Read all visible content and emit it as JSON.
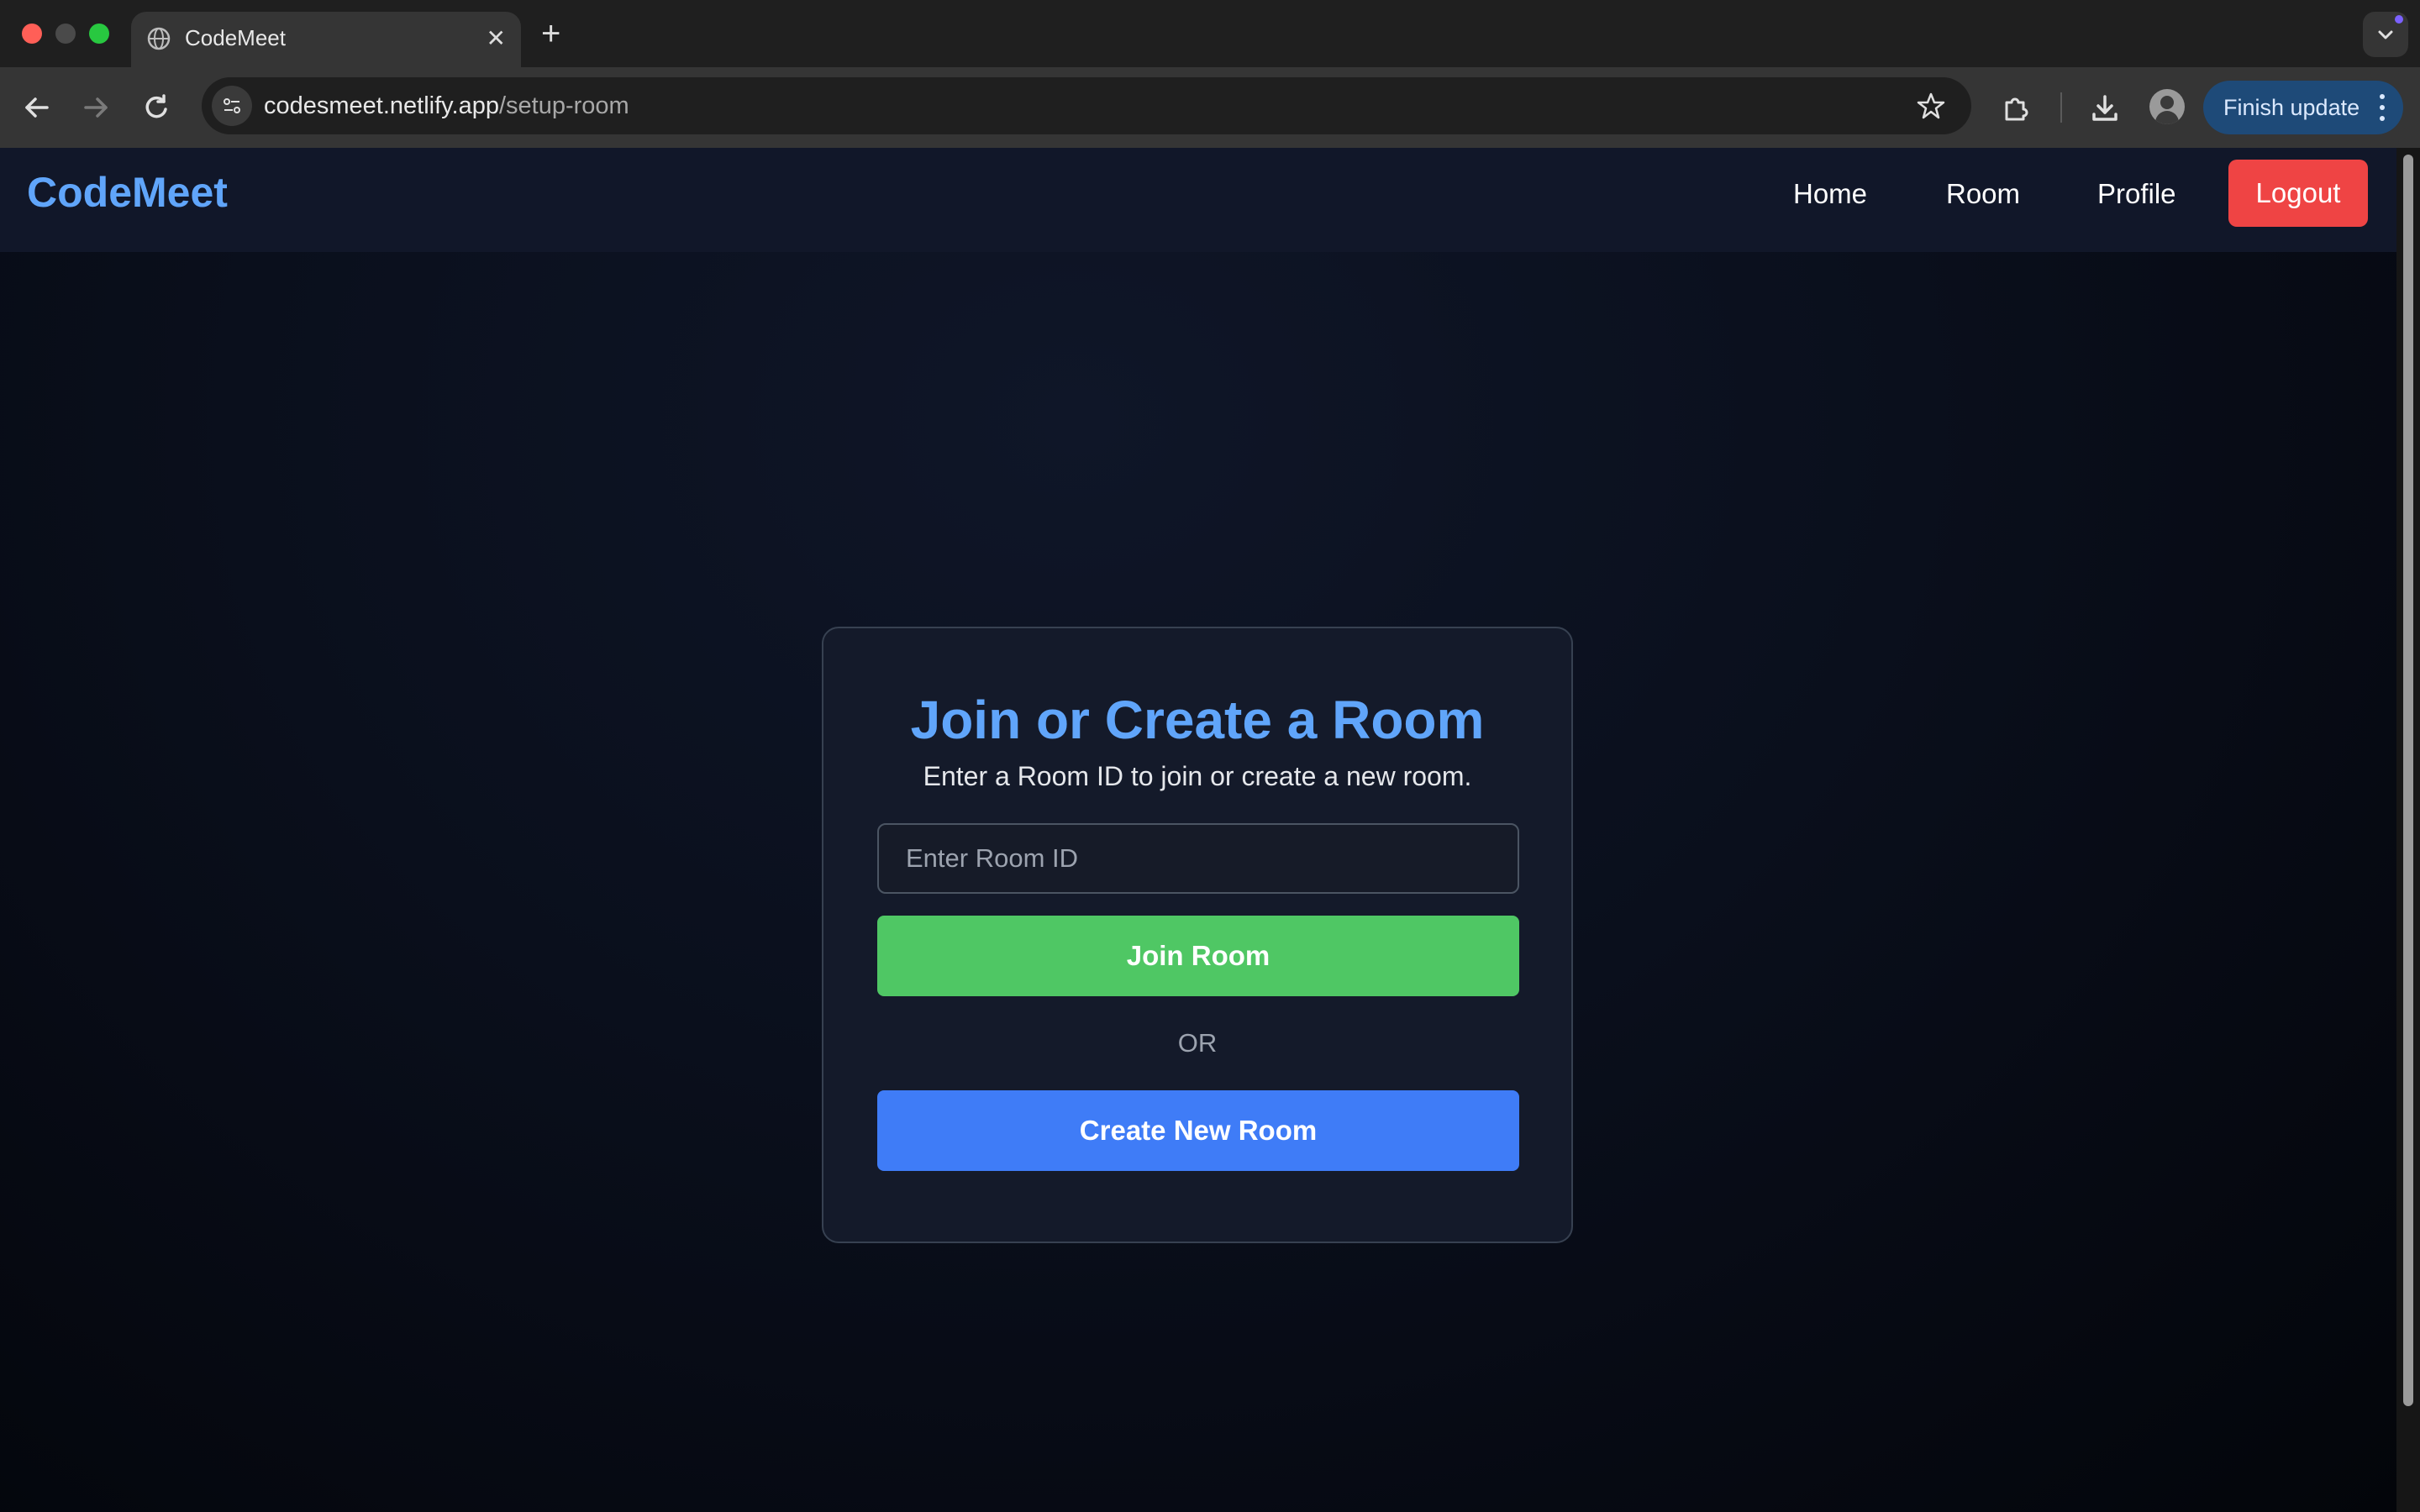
{
  "browser": {
    "tab": {
      "title": "CodeMeet"
    },
    "url": {
      "host": "codesmeet.netlify.app",
      "path": "/setup-room"
    },
    "finish_update_label": "Finish update",
    "icons": [
      "globe-icon",
      "close-icon",
      "plus-icon",
      "chevron-down-icon",
      "back-arrow-icon",
      "forward-arrow-icon",
      "reload-icon",
      "site-settings-icon",
      "star-icon",
      "extensions-icon",
      "download-icon",
      "profile-avatar",
      "kebab-menu-icon"
    ]
  },
  "navbar": {
    "brand": "CodeMeet",
    "links": [
      "Home",
      "Room",
      "Profile"
    ],
    "logout_label": "Logout"
  },
  "card": {
    "title": "Join or Create a Room",
    "subtitle": "Enter a Room ID to join or create a new room.",
    "input_placeholder": "Enter Room ID",
    "input_value": "",
    "join_label": "Join Room",
    "or_text": "OR",
    "create_label": "Create New Room"
  },
  "colors": {
    "accent_blue": "#60a5fa",
    "join_green": "#4fc764",
    "create_blue": "#3f7cf7",
    "logout_red": "#ef4444",
    "update_pill": "#1e4a78"
  }
}
